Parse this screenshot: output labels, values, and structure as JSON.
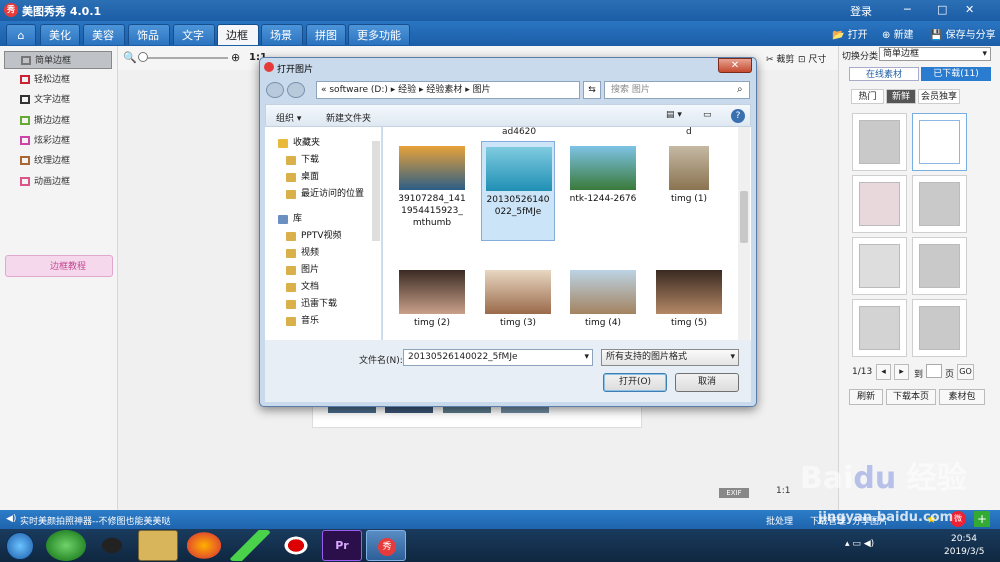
{
  "app": {
    "title": "美图秀秀 4.0.1",
    "logo_text": "秀",
    "top_right": [
      "登录",
      "─",
      "□",
      "✕"
    ]
  },
  "menu": {
    "home": "⌂",
    "tabs": [
      "美化",
      "美容",
      "饰品",
      "文字",
      "边框",
      "场景",
      "拼图",
      "更多功能 ▾"
    ],
    "active": "边框",
    "toolbar": {
      "open": "打开",
      "new": "新建",
      "save": "保存与分享"
    }
  },
  "sidebar": {
    "items": [
      "简单边框",
      "轻松边框",
      "文字边框",
      "撕边边框",
      "炫彩边框",
      "纹理边框",
      "动画边框"
    ],
    "selected": "简单边框",
    "tutorial": "边框教程"
  },
  "toolrow": {
    "zoom_text": "1:1",
    "crop": "裁剪",
    "size": "尺寸"
  },
  "right_panel": {
    "category_label": "切换分类",
    "category_value": "简单边框",
    "tabs": [
      "在线素材",
      "已下载(11)"
    ],
    "filters": [
      "热门",
      "新鲜",
      "会员独享"
    ],
    "pager": "1/13",
    "goto_label": "到",
    "page_label": "页",
    "go": "GO",
    "buttons": [
      "刷新",
      "下载本页",
      "素材包"
    ]
  },
  "status": {
    "left_text": "实时美颜拍照神器--不修图也能美美哒",
    "items": [
      "批处理",
      "下载管理",
      "分享图片"
    ],
    "badges": [
      "EXIF",
      "1:1"
    ]
  },
  "taskbar": {
    "time": "20:54",
    "date": "2019/3/5"
  },
  "dialog": {
    "title": "打开图片",
    "address": "« software (D:) ▸ 经验 ▸ 经验素材 ▸ 图片",
    "search_placeholder": "搜索 图片",
    "organize": "组织 ▾",
    "new_folder": "新建文件夹",
    "nav": [
      {
        "label": "收藏夹",
        "head": true
      },
      {
        "label": "下载"
      },
      {
        "label": "桌面"
      },
      {
        "label": "最近访问的位置"
      },
      {
        "label": "库",
        "head": true
      },
      {
        "label": "PPTV视频"
      },
      {
        "label": "视频"
      },
      {
        "label": "图片"
      },
      {
        "label": "文档"
      },
      {
        "label": "迅雷下载"
      },
      {
        "label": "音乐"
      }
    ],
    "top_labels": [
      "ad4620",
      "d"
    ],
    "files": [
      {
        "name": "39107284_1411954415923_mthumb",
        "colors": [
          "#e8a23a",
          "#2c5e86"
        ]
      },
      {
        "name": "20130526140022_5fMJe",
        "colors": [
          "#7fcbe0",
          "#1f8fb3"
        ],
        "selected": true
      },
      {
        "name": "ntk-1244-2676",
        "colors": [
          "#7ec3e6",
          "#3a7a3a"
        ]
      },
      {
        "name": "timg (1)",
        "colors": [
          "#c5b9a4",
          "#8a7350"
        ]
      },
      {
        "name": "timg (2)",
        "colors": [
          "#3b2b24",
          "#c9a08a"
        ]
      },
      {
        "name": "timg (3)",
        "colors": [
          "#e8d7c2",
          "#9a6a4a"
        ]
      },
      {
        "name": "timg (4)",
        "colors": [
          "#bcd3e4",
          "#a3835f"
        ]
      },
      {
        "name": "timg (5)",
        "colors": [
          "#3a2a22",
          "#b48866"
        ]
      }
    ],
    "filename_label": "文件名(N):",
    "filename_value": "20130526140022_5fMJe",
    "filetype": "所有支持的图片格式",
    "open": "打开(O)",
    "cancel": "取消"
  },
  "watermark": "jingyan.baidu.com"
}
